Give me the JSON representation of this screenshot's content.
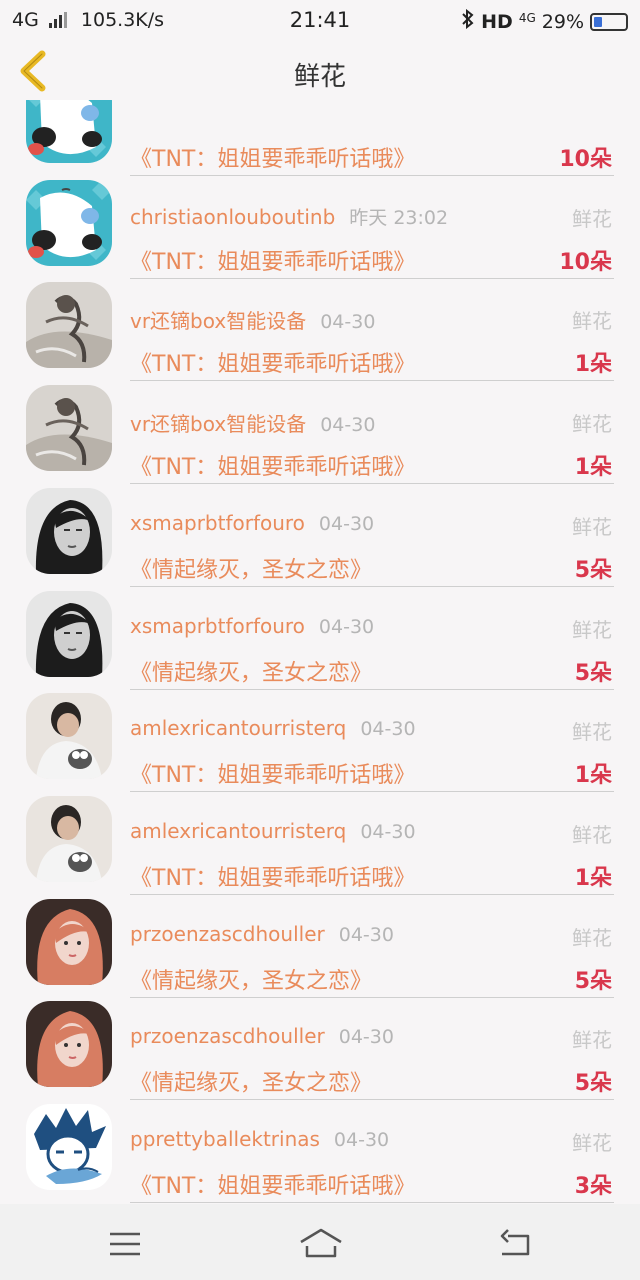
{
  "status_bar": {
    "network_type": "4G",
    "speed": "105.3K/s",
    "time": "21:41",
    "bluetooth_icon": "bluetooth-icon",
    "hd": "HD",
    "network_type_small": "4G",
    "battery": "29%",
    "battery_level": 0.29
  },
  "header": {
    "title": "鲜花",
    "back_icon": "chevron-left-icon",
    "accent": "#e8b924"
  },
  "colors": {
    "name": "#e98b5b",
    "count": "#d9374c",
    "muted": "#b5b5b5"
  },
  "list": [
    {
      "name": "",
      "time": "",
      "type": "",
      "gift": "《TNT：姐姐要乖乖听话哦》",
      "count": "10朵",
      "avatar": "panda"
    },
    {
      "name": "christiaonlouboutinb",
      "time": "昨天 23:02",
      "type": "鲜花",
      "gift": "《TNT：姐姐要乖乖听话哦》",
      "count": "10朵",
      "avatar": "panda"
    },
    {
      "name": "vr还镝box智能设备",
      "time": "04-30",
      "type": "鲜花",
      "gift": "《TNT：姐姐要乖乖听话哦》",
      "count": "1朵",
      "avatar": "sketch"
    },
    {
      "name": "vr还镝box智能设备",
      "time": "04-30",
      "type": "鲜花",
      "gift": "《TNT：姐姐要乖乖听话哦》",
      "count": "1朵",
      "avatar": "sketch"
    },
    {
      "name": "xsmaprbtforfouro",
      "time": "04-30",
      "type": "鲜花",
      "gift": "《情起缘灭，圣女之恋》",
      "count": "5朵",
      "avatar": "bw-girl"
    },
    {
      "name": "xsmaprbtforfouro",
      "time": "04-30",
      "type": "鲜花",
      "gift": "《情起缘灭，圣女之恋》",
      "count": "5朵",
      "avatar": "bw-girl"
    },
    {
      "name": "amlexricantourristerq",
      "time": "04-30",
      "type": "鲜花",
      "gift": "《TNT：姐姐要乖乖听话哦》",
      "count": "1朵",
      "avatar": "boy"
    },
    {
      "name": "amlexricantourristerq",
      "time": "04-30",
      "type": "鲜花",
      "gift": "《TNT：姐姐要乖乖听话哦》",
      "count": "1朵",
      "avatar": "boy"
    },
    {
      "name": "przoenzascdhouller",
      "time": "04-30",
      "type": "鲜花",
      "gift": "《情起缘灭，圣女之恋》",
      "count": "5朵",
      "avatar": "red-hair"
    },
    {
      "name": "przoenzascdhouller",
      "time": "04-30",
      "type": "鲜花",
      "gift": "《情起缘灭，圣女之恋》",
      "count": "5朵",
      "avatar": "red-hair"
    },
    {
      "name": "pprettyballektrinas",
      "time": "04-30",
      "type": "鲜花",
      "gift": "《TNT：姐姐要乖乖听话哦》",
      "count": "3朵",
      "avatar": "anime"
    },
    {
      "name": "pprettyballektrinas",
      "time": "04-30",
      "type": "鲜花",
      "gift": "",
      "count": "",
      "avatar": "anime"
    }
  ],
  "nav_bar": {
    "menu_icon": "menu-icon",
    "home_icon": "home-icon",
    "back_icon": "return-icon"
  }
}
